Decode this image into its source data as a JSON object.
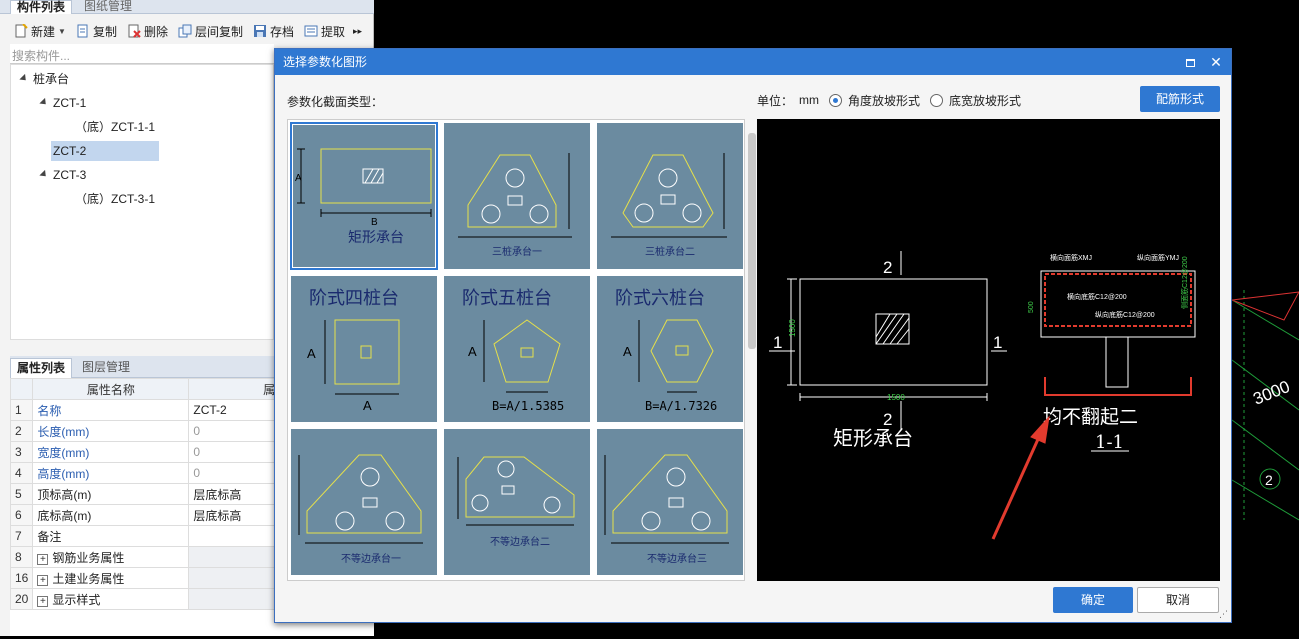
{
  "left_tabs": [
    "构件列表",
    "图纸管理"
  ],
  "toolbar": {
    "new_label": "新建",
    "copy_label": "复制",
    "delete_label": "删除",
    "floor_copy_label": "层间复制",
    "save_label": "存档",
    "extract_label": "提取"
  },
  "search": {
    "placeholder": "搜索构件..."
  },
  "tree": [
    {
      "label": "桩承台",
      "level": 0
    },
    {
      "label": "ZCT-1",
      "level": 1
    },
    {
      "label": "（底）ZCT-1-1",
      "level": 2
    },
    {
      "label": "ZCT-2",
      "level": 1,
      "selected": true
    },
    {
      "label": "ZCT-3",
      "level": 1
    },
    {
      "label": "（底）ZCT-3-1",
      "level": 2
    }
  ],
  "prop_tabs": [
    "属性列表",
    "图层管理"
  ],
  "prop_headers": [
    "属性名称",
    "属性值"
  ],
  "props": [
    {
      "num": "1",
      "name": "名称",
      "value": "ZCT-2",
      "blue": true
    },
    {
      "num": "2",
      "name": "长度(mm)",
      "value": "0",
      "blue": true
    },
    {
      "num": "3",
      "name": "宽度(mm)",
      "value": "0",
      "blue": true
    },
    {
      "num": "4",
      "name": "高度(mm)",
      "value": "0",
      "blue": true
    },
    {
      "num": "5",
      "name": "顶标高(m)",
      "value": "层底标高"
    },
    {
      "num": "6",
      "name": "底标高(m)",
      "value": "层底标高"
    },
    {
      "num": "7",
      "name": "备注",
      "value": ""
    },
    {
      "num": "8",
      "name": "钢筋业务属性",
      "value": "",
      "expand": true
    },
    {
      "num": "16",
      "name": "土建业务属性",
      "value": "",
      "expand": true
    },
    {
      "num": "20",
      "name": "显示样式",
      "value": "",
      "expand": true
    }
  ],
  "dialog": {
    "title": "选择参数化图形",
    "type_label": "参数化截面类型：",
    "unit_label": "单位：",
    "unit_value": "mm",
    "radio_angle": "角度放坡形式",
    "radio_width": "底宽放坡形式",
    "config_button": "配筋形式",
    "ok_button": "确定",
    "cancel_button": "取消"
  },
  "shapes": [
    {
      "caption": "矩形承台",
      "selected": true
    },
    {
      "caption": "三桩承台一"
    },
    {
      "caption": "三桩承台二"
    },
    {
      "caption": "阶式四桩台",
      "dim": "A"
    },
    {
      "caption": "阶式五桩台",
      "dim": "B=A/1.5385"
    },
    {
      "caption": "阶式六桩台",
      "dim": "B=A/1.7326"
    },
    {
      "caption": "不等边承台一"
    },
    {
      "caption": "不等边承台二"
    },
    {
      "caption": "不等边承台三"
    }
  ],
  "preview": {
    "section_top": "2",
    "section_bottom": "2",
    "side_left": "1",
    "side_right": "1",
    "dim_width": "1500",
    "dim_height": "1500",
    "title": "矩形承台",
    "rebar_h_top": "横向面筋XMJ",
    "rebar_v_top": "纵向面筋YMJ",
    "rebar_h_bottom": "横向底筋C12@200",
    "rebar_v_bottom": "纵向底筋C12@200",
    "side_rebar": "侧面筋C12@200",
    "height_dim": "500",
    "note": "均不翻起二",
    "section_label": "1-1"
  },
  "viewport": {
    "label_3000": "3000",
    "label_2": "2"
  }
}
